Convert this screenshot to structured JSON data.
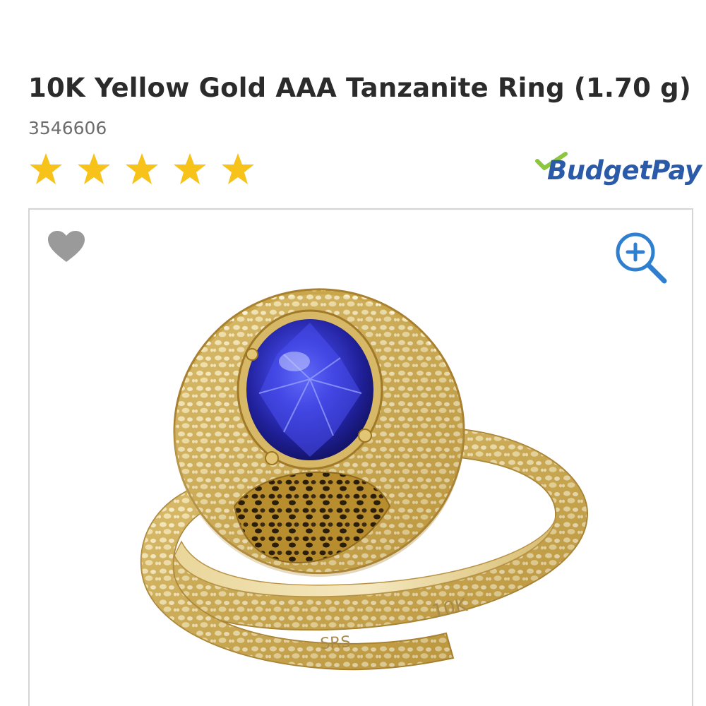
{
  "product": {
    "title": "10K Yellow Gold AAA Tanzanite Ring (1.70 g)",
    "sku": "3546606",
    "rating": {
      "value": 5,
      "max": 5
    },
    "image_alt": "10K Yellow Gold AAA Tanzanite Ring",
    "band_stamp_1": "10K",
    "band_stamp_2": "SRS"
  },
  "badges": {
    "budgetpay_label": "BudgetPay"
  },
  "icons": {
    "wishlist": "heart-icon",
    "zoom": "zoom-in-icon",
    "star": "star-icon"
  },
  "colors": {
    "star": "#f7c21a",
    "brand_blue": "#2b5aa8",
    "brand_green": "#8cc63f",
    "heart_gray": "#9a9a9a",
    "zoom_blue": "#2f7fd0"
  }
}
